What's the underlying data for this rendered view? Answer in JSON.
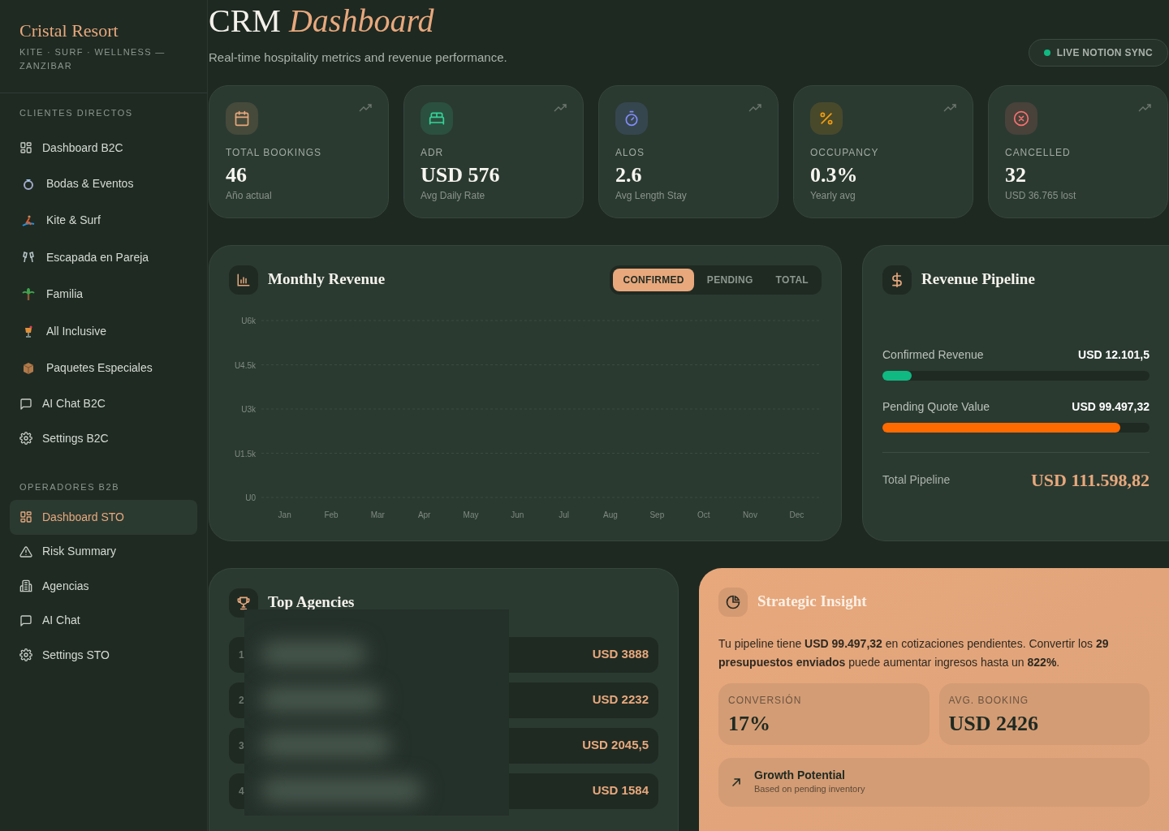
{
  "sidebar": {
    "brand": "Cristal Resort",
    "tagline": "KITE · SURF · WELLNESS — ZANZIBAR",
    "sections": [
      {
        "heading": "CLIENTES DIRECTOS",
        "items": [
          {
            "label": "Dashboard B2C",
            "kind": "grid",
            "selected": false
          },
          {
            "label": "Bodas & Eventos",
            "kind": "ring",
            "selected": false
          },
          {
            "label": "Kite & Surf",
            "kind": "surf",
            "selected": false
          },
          {
            "label": "Escapada en Pareja",
            "kind": "glasses",
            "selected": false
          },
          {
            "label": "Familia",
            "kind": "palm",
            "selected": false
          },
          {
            "label": "All Inclusive",
            "kind": "cocktail",
            "selected": false
          },
          {
            "label": "Paquetes Especiales",
            "kind": "package",
            "selected": false
          },
          {
            "label": "AI Chat B2C",
            "kind": "chat",
            "selected": false
          },
          {
            "label": "Settings B2C",
            "kind": "gear",
            "selected": false
          }
        ]
      },
      {
        "heading": "OPERADORES B2B",
        "items": [
          {
            "label": "Dashboard STO",
            "kind": "grid",
            "selected": true
          },
          {
            "label": "Risk Summary",
            "kind": "warning",
            "selected": false
          },
          {
            "label": "Agencias",
            "kind": "building",
            "selected": false
          },
          {
            "label": "AI Chat",
            "kind": "chat",
            "selected": false
          },
          {
            "label": "Settings STO",
            "kind": "gear",
            "selected": false
          }
        ]
      }
    ]
  },
  "header": {
    "title": "CRM",
    "title_accent": "Dashboard",
    "subtitle": "Real-time hospitality metrics and revenue performance.",
    "sync_badge": "LIVE NOTION SYNC"
  },
  "stats": [
    {
      "label": "TOTAL BOOKINGS",
      "value": "46",
      "note": "Año actual",
      "kind": "calendar",
      "color": "#e8a87c"
    },
    {
      "label": "ADR",
      "value": "USD 576",
      "note": "Avg Daily Rate",
      "kind": "bed",
      "color": "#34d399"
    },
    {
      "label": "ALOS",
      "value": "2.6",
      "note": "Avg Length Stay",
      "kind": "timer",
      "color": "#818cf8"
    },
    {
      "label": "OCCUPANCY",
      "value": "0.3%",
      "note": "Yearly avg",
      "kind": "percent",
      "color": "#f59e0b"
    },
    {
      "label": "CANCELLED",
      "value": "32",
      "note": "USD 36.765 lost",
      "kind": "cancel",
      "color": "#f87171"
    }
  ],
  "monthly_revenue": {
    "title": "Monthly Revenue",
    "tabs": [
      {
        "label": "CONFIRMED",
        "selected": true
      },
      {
        "label": "PENDING",
        "selected": false
      },
      {
        "label": "TOTAL",
        "selected": false
      }
    ],
    "axes": {
      "x_labels": [
        "Jan",
        "Feb",
        "Mar",
        "Apr",
        "May",
        "Jun",
        "Jul",
        "Aug",
        "Sep",
        "Oct",
        "Nov",
        "Dec"
      ],
      "y_labels": [
        "U6k",
        "U4.5k",
        "U3k",
        "U1.5k",
        "U0"
      ]
    }
  },
  "pipeline": {
    "title": "Revenue Pipeline",
    "rows": [
      {
        "label": "Confirmed Revenue",
        "value": "USD 12.101,5",
        "level": 0.108,
        "color": "#10b981"
      },
      {
        "label": "Pending Quote Value",
        "value": "USD 99.497,32",
        "level": 0.89,
        "color": "#ff6a00"
      }
    ],
    "total_label": "Total Pipeline",
    "total_value": "USD 111.598,82"
  },
  "top_agencies": {
    "title": "Top Agencies",
    "rows": [
      {
        "rank": "1",
        "amount": "USD 3888"
      },
      {
        "rank": "2",
        "amount": "USD 2232"
      },
      {
        "rank": "3",
        "amount": "USD 2045,5"
      },
      {
        "rank": "4",
        "amount": "USD 1584"
      }
    ]
  },
  "insight": {
    "title": "Strategic Insight",
    "text": "Tu pipeline tiene **USD 99.497,32** en cotizaciones pendientes. Convertir los **29 presupuestos enviados** puede aumentar ingresos hasta un **822%**.",
    "metrics": [
      {
        "label": "CONVERSIÓN",
        "value": "17%"
      },
      {
        "label": "AVG. BOOKING",
        "value": "USD 2426"
      }
    ],
    "growth": {
      "title": "Growth Potential",
      "note": "Based on pending inventory"
    }
  }
}
